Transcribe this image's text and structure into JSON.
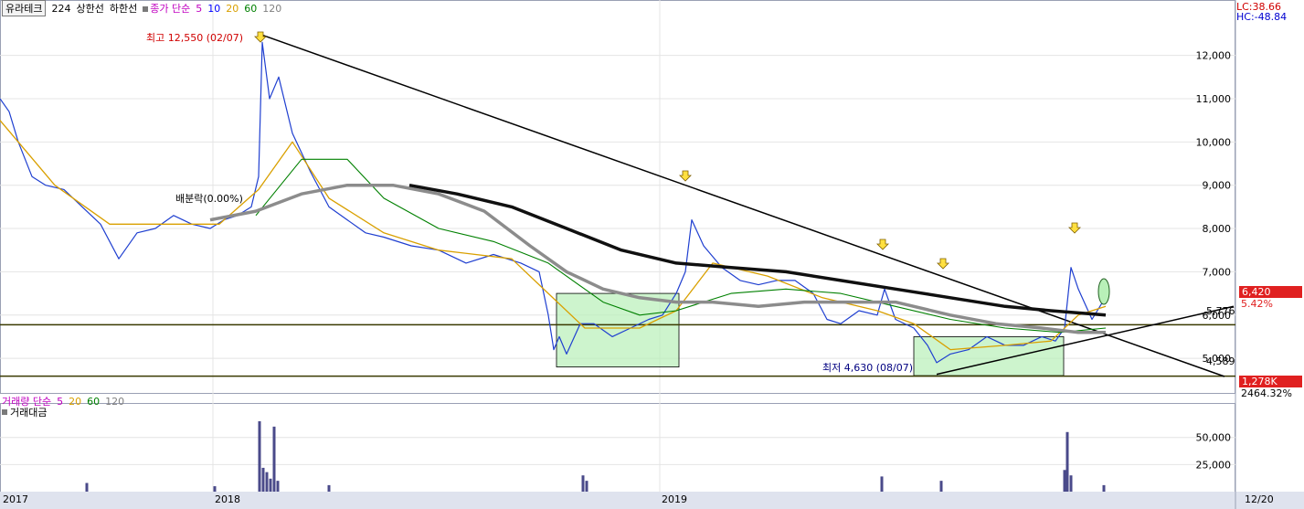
{
  "header": {
    "stock_name": "유라테크",
    "indicator_value": "224",
    "upper_limit": "상한선",
    "lower_limit": "하한선",
    "ma_label": "종가 단순",
    "ma_periods": [
      "5",
      "10",
      "20",
      "60",
      "120"
    ],
    "ma_colors": [
      "#c000c0",
      "#0000ff",
      "#d9a000",
      "#008000",
      "#808080"
    ]
  },
  "right_panel": {
    "lc": "LC:38.66",
    "hc": "HC:-48.84",
    "current_price": "6,420",
    "change_pct": "5.42%",
    "volume_badge": "1,278K",
    "volume_pct": "2464.32%",
    "date_label": "12/20",
    "price_ticks": [
      "12,000",
      "11,000",
      "10,000",
      "9,000",
      "8,000",
      "7,000",
      "6,000",
      "5,000"
    ],
    "volume_ticks": [
      "50,000",
      "25,000"
    ]
  },
  "volume_panel": {
    "legend_label": "거래량 단순",
    "legend_periods": [
      "5",
      "20",
      "60",
      "120"
    ],
    "title": "거래대금"
  },
  "annotations": {
    "high": "최고 12,550 (02/07)",
    "low": "최저 4,630 (08/07)",
    "rights_label": "배분락(0.00%)",
    "level_upper": "5,776",
    "level_lower": "4,589"
  },
  "chart_data": {
    "type": "line",
    "title": "",
    "x_labels": [
      "2017",
      "2018",
      "2019"
    ],
    "ylim": [
      4200,
      12900
    ],
    "series": [
      {
        "name": "",
        "color": "#1f3fd0",
        "x": [
          0,
          10,
          20,
          35,
          50,
          70,
          90,
          110,
          130,
          150,
          170,
          190,
          210,
          230,
          245,
          260,
          275,
          283,
          287,
          295,
          305,
          320,
          340,
          360,
          380,
          400,
          420,
          450,
          480,
          510,
          540,
          570,
          590,
          600,
          606,
          612,
          620,
          635,
          650,
          670,
          690,
          710,
          725,
          740,
          750,
          757,
          770,
          790,
          810,
          830,
          850,
          870,
          890,
          905,
          920,
          940,
          960,
          968,
          980,
          1000,
          1015,
          1025,
          1040,
          1060,
          1080,
          1100,
          1120,
          1140,
          1155,
          1165,
          1172,
          1180,
          1195,
          1210
        ],
        "y": [
          11000,
          10700,
          10000,
          9200,
          9000,
          8900,
          8500,
          8100,
          7300,
          7900,
          8000,
          8300,
          8100,
          8000,
          8200,
          8300,
          8500,
          9200,
          12300,
          11000,
          11500,
          10200,
          9300,
          8500,
          8200,
          7900,
          7800,
          7600,
          7500,
          7200,
          7400,
          7200,
          7000,
          6000,
          5200,
          5500,
          5100,
          5800,
          5800,
          5500,
          5700,
          5900,
          6000,
          6500,
          7000,
          8200,
          7600,
          7100,
          6800,
          6700,
          6800,
          6800,
          6500,
          5900,
          5800,
          6100,
          6000,
          6600,
          5900,
          5700,
          5300,
          4900,
          5100,
          5200,
          5500,
          5300,
          5300,
          5500,
          5400,
          5700,
          7100,
          6600,
          5900,
          6420
        ]
      },
      {
        "name": "",
        "color": "#d9a000",
        "x": [
          0,
          60,
          120,
          180,
          240,
          283,
          320,
          360,
          420,
          480,
          560,
          600,
          640,
          700,
          740,
          780,
          840,
          900,
          960,
          1000,
          1040,
          1100,
          1150,
          1180,
          1210
        ],
        "y": [
          10500,
          9000,
          8100,
          8100,
          8100,
          8900,
          10000,
          8700,
          7900,
          7500,
          7300,
          6500,
          5700,
          5700,
          6100,
          7200,
          6900,
          6400,
          6100,
          5800,
          5200,
          5300,
          5400,
          6000,
          6200
        ]
      },
      {
        "name": "",
        "color": "#008000",
        "x": [
          280,
          330,
          380,
          420,
          480,
          540,
          600,
          660,
          700,
          740,
          800,
          860,
          920,
          980,
          1040,
          1100,
          1160,
          1210
        ],
        "y": [
          8300,
          9600,
          9600,
          8700,
          8000,
          7700,
          7200,
          6300,
          6000,
          6100,
          6500,
          6600,
          6500,
          6200,
          5900,
          5700,
          5600,
          5700
        ]
      },
      {
        "name": "",
        "color": "#8c8c8c",
        "x": [
          230,
          280,
          330,
          380,
          430,
          480,
          530,
          580,
          620,
          660,
          700,
          740,
          780,
          830,
          880,
          930,
          980,
          1040,
          1090,
          1140,
          1180,
          1210
        ],
        "y": [
          8200,
          8400,
          8800,
          9000,
          9000,
          8800,
          8400,
          7600,
          7000,
          6600,
          6400,
          6300,
          6300,
          6200,
          6300,
          6300,
          6300,
          6000,
          5800,
          5700,
          5600,
          5600
        ]
      },
      {
        "name": "",
        "color": "#101010",
        "x": [
          448,
          500,
          560,
          620,
          680,
          740,
          800,
          860,
          920,
          980,
          1040,
          1100,
          1150,
          1210
        ],
        "y": [
          9000,
          8800,
          8500,
          8000,
          7500,
          7200,
          7100,
          7000,
          6800,
          6600,
          6400,
          6200,
          6100,
          6000
        ]
      }
    ],
    "volume": {
      "x": [
        95,
        235,
        284,
        288,
        292,
        296,
        300,
        304,
        360,
        638,
        642,
        965,
        1030,
        1165,
        1168,
        1172,
        1208
      ],
      "y": [
        8000,
        5000,
        65000,
        22000,
        18000,
        12000,
        60000,
        10000,
        6000,
        15000,
        10000,
        14000,
        10000,
        20000,
        55000,
        15000,
        6000
      ],
      "ylim": [
        0,
        70000
      ]
    },
    "levels": [
      5776,
      4589
    ],
    "grid": "on"
  }
}
